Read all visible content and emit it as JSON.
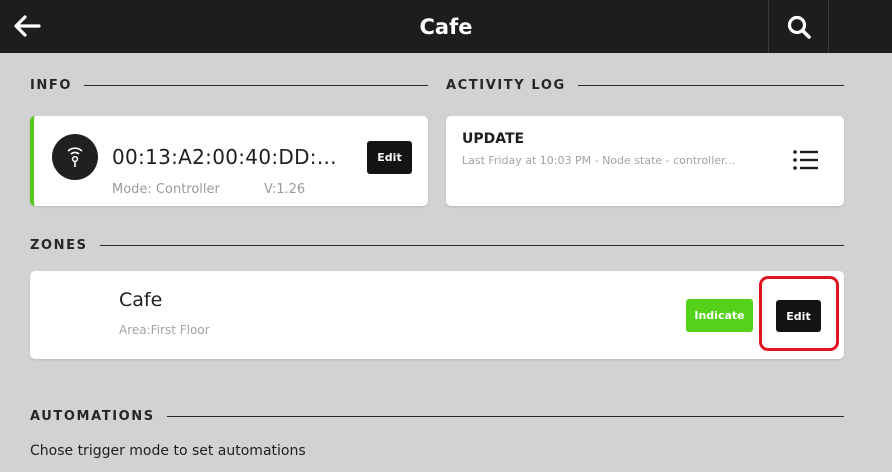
{
  "header": {
    "title": "Cafe",
    "back_icon": "arrow-left-icon",
    "search_icon": "search-icon"
  },
  "sections": {
    "info": "INFO",
    "activity_log": "ACTIVITY LOG",
    "zones": "ZONES",
    "automations": "AUTOMATIONS"
  },
  "info_card": {
    "icon": "wifi-node-icon",
    "node_id": "00:13:A2:00:40:DD:...",
    "mode": "Mode: Controller",
    "version": "V:1.26",
    "edit_label": "Edit",
    "status_color": "#56c81c"
  },
  "activity_card": {
    "title": "UPDATE",
    "subtitle": "Last Friday at 10:03 PM - Node state - controller...",
    "list_icon": "list-icon"
  },
  "zone": {
    "name": "Cafe",
    "area": "Area:First Floor",
    "indicate_label": "Indicate",
    "edit_label": "Edit"
  },
  "automations": {
    "hint": "Chose trigger mode to set automations"
  },
  "colors": {
    "topbar": "#1d1d1d",
    "background": "#d2d2d2",
    "accent_green": "#55d11a",
    "highlight_red": "#e0141e"
  }
}
